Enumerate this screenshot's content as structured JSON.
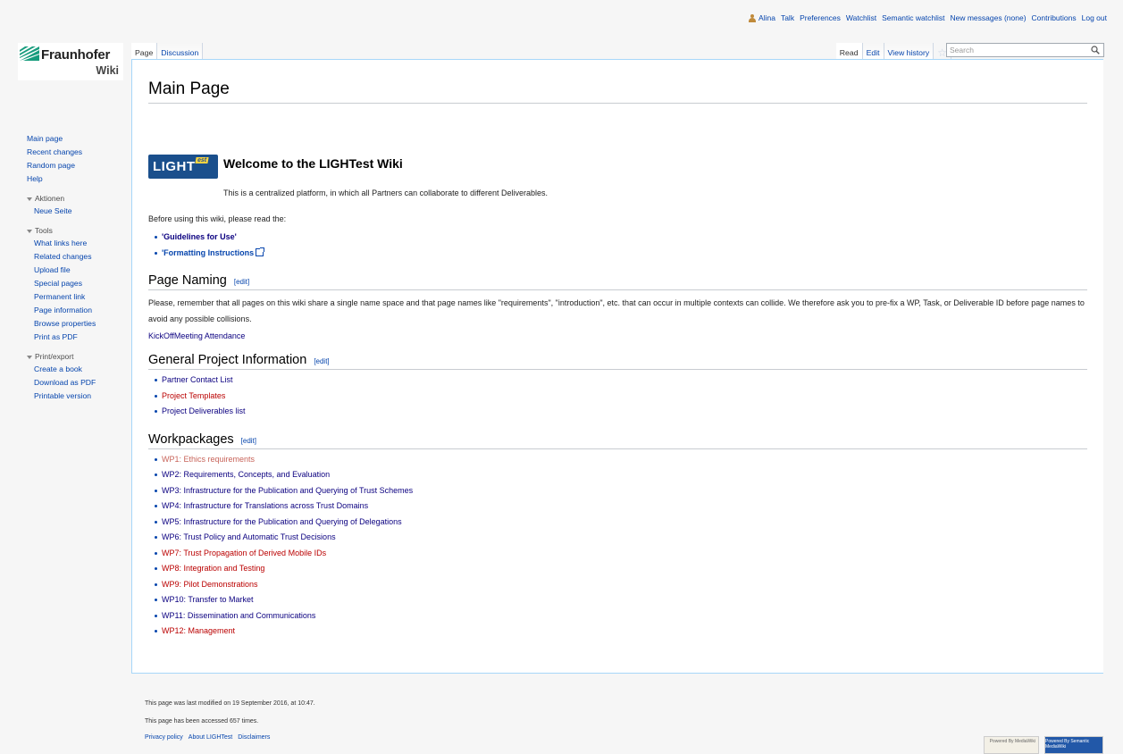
{
  "personal_tools": {
    "user": "Alina",
    "items": [
      "Talk",
      "Preferences",
      "Watchlist",
      "Semantic watchlist",
      "New messages (none)",
      "Contributions",
      "Log out"
    ]
  },
  "logo": {
    "brand": "Fraunhofer",
    "sub": "Wiki",
    "brand_color": "#179c7d"
  },
  "sidebar": {
    "nav": [
      "Main page",
      "Recent changes",
      "Random page",
      "Help"
    ],
    "aktionen": {
      "heading": "Aktionen",
      "items": [
        "Neue Seite"
      ]
    },
    "tools": {
      "heading": "Tools",
      "items": [
        "What links here",
        "Related changes",
        "Upload file",
        "Special pages",
        "Permanent link",
        "Page information",
        "Browse properties",
        "Print as PDF"
      ]
    },
    "print": {
      "heading": "Print/export",
      "items": [
        "Create a book",
        "Download as PDF",
        "Printable version"
      ]
    }
  },
  "tabs": {
    "page": "Page",
    "discussion": "Discussion",
    "read": "Read",
    "edit": "Edit",
    "history": "View history"
  },
  "search": {
    "placeholder": "Search"
  },
  "content": {
    "title": "Main Page",
    "logo_text": "LIGHT",
    "logo_est": "est",
    "welcome_title": "Welcome to the LIGHTest Wiki",
    "intro": "This is a centralized platform, in which all Partners can collaborate to different Deliverables.",
    "before": "Before using this wiki, please read the:",
    "guidelines": [
      "'Guidelines for Use'",
      "'Formatting Instructions"
    ],
    "naming": {
      "heading": "Page Naming",
      "edit": "[edit]",
      "text": "Please, remember that all pages on this wiki share a single name space and that page names like \"requirements\", \"introduction\", etc. that can occur in multiple contexts can collide. We therefore ask you to pre-fix a WP, Task, or Deliverable ID before page names to avoid any possible collisions.",
      "link": "KickOffMeeting Attendance"
    },
    "general": {
      "heading": "General Project Information",
      "edit": "[edit]",
      "items": [
        "Partner Contact List",
        "Project Templates",
        "Project Deliverables list"
      ]
    },
    "workpackages": {
      "heading": "Workpackages",
      "edit": "[edit]",
      "items": [
        "WP1: Ethics requirements",
        "WP2: Requirements, Concepts, and Evaluation",
        "WP3: Infrastructure for the Publication and Querying of Trust Schemes",
        "WP4: Infrastructure for Translations across Trust Domains",
        "WP5: Infrastructure for the Publication and Querying of Delegations",
        "WP6: Trust Policy and Automatic Trust Decisions",
        "WP7: Trust Propagation of Derived Mobile IDs",
        "WP8: Integration and Testing",
        "WP9: Pilot Demonstrations",
        "WP10: Transfer to Market",
        "WP11: Dissemination and Communications",
        "WP12: Management"
      ]
    }
  },
  "footer": {
    "modified": "This page was last modified on 19 September 2016, at 10:47.",
    "accessed": "This page has been accessed 657 times.",
    "links": [
      "Privacy policy",
      "About LIGHTest",
      "Disclaimers"
    ],
    "badges": [
      "Powered By MediaWiki",
      "Powered By Semantic MediaWiki"
    ]
  }
}
